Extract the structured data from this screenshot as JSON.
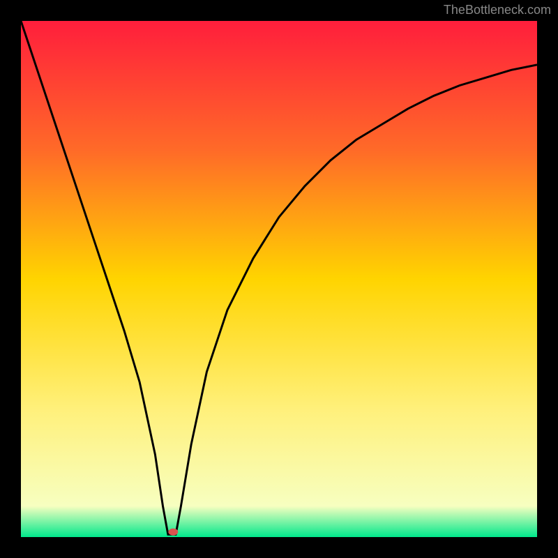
{
  "attribution": "TheBottleneck.com",
  "chart_data": {
    "type": "line",
    "title": "",
    "xlabel": "",
    "ylabel": "",
    "xlim": [
      0,
      100
    ],
    "ylim": [
      0,
      100
    ],
    "gradient_stops": [
      {
        "offset": 0,
        "color": "#ff1e3c"
      },
      {
        "offset": 25,
        "color": "#ff6a28"
      },
      {
        "offset": 50,
        "color": "#ffd400"
      },
      {
        "offset": 75,
        "color": "#fff07a"
      },
      {
        "offset": 94,
        "color": "#f7ffc0"
      },
      {
        "offset": 100,
        "color": "#00e88c"
      }
    ],
    "curve": {
      "x": [
        0,
        2,
        5,
        8,
        11,
        14,
        17,
        20,
        23,
        26,
        27.5,
        28.5,
        30,
        31,
        33,
        36,
        40,
        45,
        50,
        55,
        60,
        65,
        70,
        75,
        80,
        85,
        90,
        95,
        100
      ],
      "y": [
        100,
        94,
        85,
        76,
        67,
        58,
        49,
        40,
        30,
        16,
        6,
        0.5,
        0.5,
        6,
        18,
        32,
        44,
        54,
        62,
        68,
        73,
        77,
        80,
        83,
        85.5,
        87.5,
        89,
        90.5,
        91.5
      ]
    },
    "marker": {
      "x": 29.5,
      "y": 1
    },
    "marker_color": "#d9534f"
  }
}
